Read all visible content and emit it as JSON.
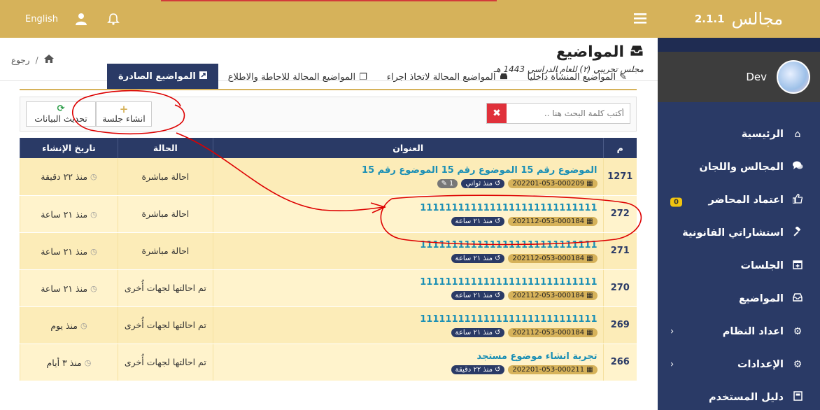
{
  "colors": {
    "primary": "#2a3a66",
    "accent": "#d6b25a",
    "row": "#fcecb8",
    "danger": "#e0313b",
    "link": "#1a8fb5"
  },
  "brand": {
    "name": "مجالس",
    "version": "2.1.1"
  },
  "user": {
    "name": "Dev"
  },
  "topbar": {
    "language": "English"
  },
  "sidebar": {
    "items": [
      {
        "label": "الرئيسية",
        "icon": "home-icon"
      },
      {
        "label": "المجالس واللجان",
        "icon": "comments-icon"
      },
      {
        "label": "اعتماد المحاضر",
        "icon": "thumbs-up-icon",
        "badge": "0"
      },
      {
        "label": "استشاراتي القانونية",
        "icon": "gavel-icon"
      },
      {
        "label": "الجلسات",
        "icon": "calendar-plus-icon"
      },
      {
        "label": "المواضيع",
        "icon": "inbox-icon"
      },
      {
        "label": "اعداد النظام",
        "icon": "cogs-icon",
        "chevron": "‹"
      },
      {
        "label": "الإعدادات",
        "icon": "cogs-icon",
        "chevron": "‹"
      },
      {
        "label": "دليل المستخدم",
        "icon": "book-icon"
      }
    ]
  },
  "page": {
    "title": "المواضيع",
    "subtitle": "مجلس تجريبي (٢) للعام الدراسي 1443 هـ",
    "breadcrumb": {
      "back": "رجوع",
      "separator": "/"
    }
  },
  "tabs": [
    {
      "label": "المواضيع المنشأة داخليا"
    },
    {
      "label": "المواضيع المحالة لاتخاذ اجراء"
    },
    {
      "label": "المواضيع المحالة للاحاطة والاطلاع"
    },
    {
      "label": "المواضيع الصادرة"
    }
  ],
  "toolbar": {
    "search_placeholder": "أكتب كلمة البحث هنا ..",
    "clear": "✖",
    "new_session": "انشاء جلسة",
    "refresh": "تحديث البيانات"
  },
  "table": {
    "headers": {
      "num": "م",
      "title": "العنوان",
      "state": "الحالة",
      "date": "تاريخ الإنشاء"
    },
    "rows": [
      {
        "num": "1271",
        "title": "الموضوع رقم 15 الموضوع رقم 15 الموضوع رقم 15",
        "code": "202201-053-000209",
        "time": "منذ ثواني",
        "attach": "1",
        "state": "احالة مباشرة",
        "date": "منذ ٢٢ دقيقة"
      },
      {
        "num": "272",
        "title": "1111111111111111111111111111",
        "code": "202112-053-000184",
        "time": "منذ ٢١ ساعة",
        "state": "احالة مباشرة",
        "date": "منذ ٢١ ساعة"
      },
      {
        "num": "271",
        "title": "1111111111111111111111111111",
        "code": "202112-053-000184",
        "time": "منذ ٢١ ساعة",
        "state": "احالة مباشرة",
        "date": "منذ ٢١ ساعة"
      },
      {
        "num": "270",
        "title": "1111111111111111111111111111",
        "code": "202112-053-000184",
        "time": "منذ ٢١ ساعة",
        "state": "تم احالتها لجهات أُخرى",
        "date": "منذ ٢١ ساعة"
      },
      {
        "num": "269",
        "title": "1111111111111111111111111111",
        "code": "202112-053-000184",
        "time": "منذ ٢١ ساعة",
        "state": "تم احالتها لجهات أُخرى",
        "date": "منذ يوم"
      },
      {
        "num": "266",
        "title": "تجربة انشاء موضوع مستجد",
        "code": "202201-053-000211",
        "time": "منذ ٢٢ دقيقة",
        "state": "تم احالتها لجهات أُخرى",
        "date": "منذ ٣ أيام"
      }
    ]
  }
}
